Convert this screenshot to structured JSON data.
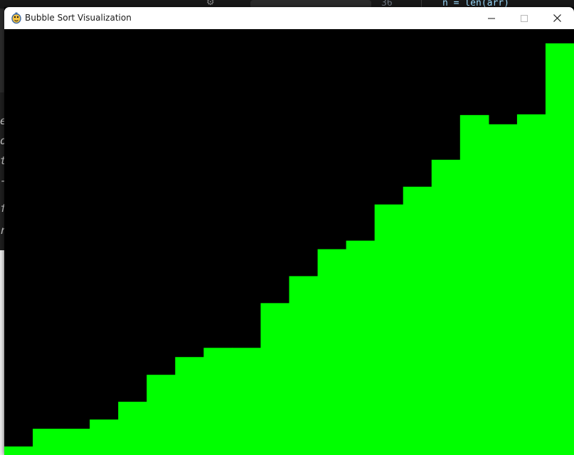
{
  "window": {
    "title": "Bubble Sort Visualization",
    "icon": "pygame-snake-icon",
    "controls": {
      "minimize_icon": "minimize-icon",
      "maximize_icon": "maximize-icon",
      "close_icon": "close-icon"
    }
  },
  "background_editor": {
    "line_number": "36",
    "code_line": "n = len(arr)",
    "partial_letters": [
      "e",
      "o",
      "t",
      "-",
      "f",
      "r"
    ]
  },
  "colors": {
    "bar": "#00ff00",
    "canvas": "#000000",
    "titlebar": "#ffffff"
  },
  "chart_data": {
    "type": "bar",
    "bar_color": "#00ff00",
    "background": "#000000",
    "sorted_ascending": true,
    "ylim": [
      0,
      580
    ],
    "values": [
      12,
      37,
      37,
      50,
      75,
      113,
      138,
      151,
      151,
      214,
      252,
      290,
      302,
      353,
      378,
      416,
      479,
      466,
      480,
      580
    ]
  }
}
